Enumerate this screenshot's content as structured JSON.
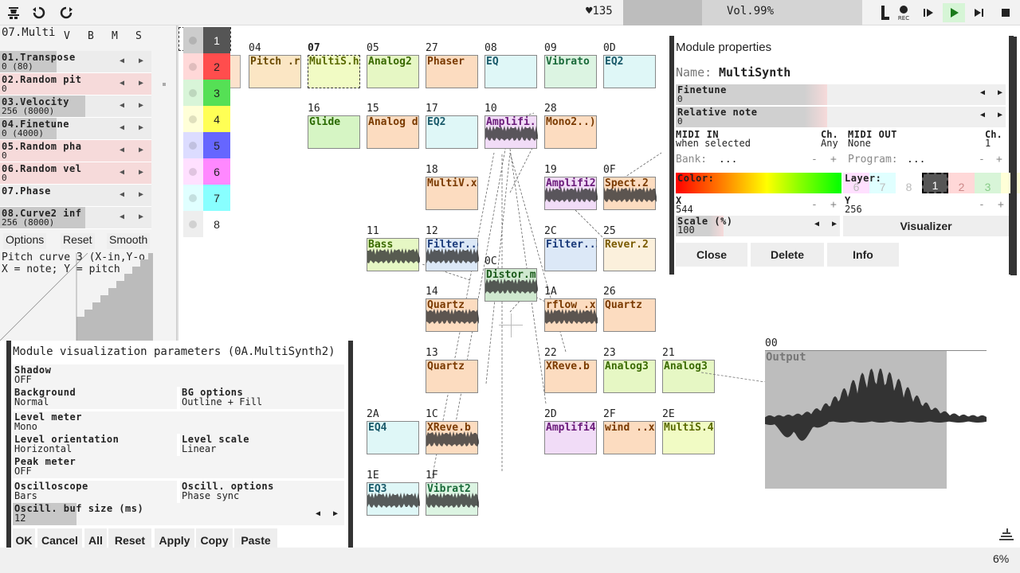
{
  "topbar": {
    "cpu": "♥135",
    "volume": "Vol.99%",
    "volume_fraction": 0.99
  },
  "left_panel": {
    "module_title": "07.Multi",
    "header_cols": [
      "V",
      "B",
      "M",
      "S"
    ],
    "controllers": [
      {
        "name": "01.Transpose",
        "value": "0 (80)",
        "fill": 0.5,
        "tint": "#ececec"
      },
      {
        "name": "02.Random pit",
        "value": "0",
        "fill": 0.0,
        "tint": "#f6dada"
      },
      {
        "name": "03.Velocity",
        "value": "256 (8000)",
        "fill": 0.75,
        "tint": "#ececec"
      },
      {
        "name": "04.Finetune",
        "value": "0 (4000)",
        "fill": 0.5,
        "tint": "#ececec"
      },
      {
        "name": "05.Random pha",
        "value": "0",
        "fill": 0.0,
        "tint": "#f6dada"
      },
      {
        "name": "06.Random vel",
        "value": "0",
        "fill": 0.0,
        "tint": "#f6dada"
      },
      {
        "name": "07.Phase",
        "value": "",
        "fill": 0.0,
        "tint": "#ececec"
      },
      {
        "name": "08.Curve2 inf",
        "value": "256 (8000)",
        "fill": 0.75,
        "tint": "#ececec"
      }
    ],
    "buttons": [
      "Options",
      "Reset",
      "Smooth"
    ],
    "curve_text_1": "Pitch curve 3 (X-in,Y-o",
    "curve_text_2": "X = note; Y = pitch"
  },
  "layers": {
    "items": [
      {
        "label": "1",
        "color": "#555555",
        "dot": "#cccccc"
      },
      {
        "label": "2",
        "color": "#ff4d4d",
        "dot": "#ffd8d8"
      },
      {
        "label": "3",
        "color": "#55e055",
        "dot": "#d8f5d8"
      },
      {
        "label": "4",
        "color": "#ffff55",
        "dot": "#ffffd8"
      },
      {
        "label": "5",
        "color": "#6666ff",
        "dot": "#dcdcff"
      },
      {
        "label": "6",
        "color": "#ff88ff",
        "dot": "#ffe0ff"
      },
      {
        "label": "7",
        "color": "#88ffff",
        "dot": "#e0ffff"
      },
      {
        "label": "8",
        "color": "#ffffff",
        "dot": "#eeeeee"
      }
    ]
  },
  "modules": [
    {
      "id": "04",
      "label": "Pitch .r",
      "color": "#fbe6c4",
      "text": "#6a4a00"
    },
    {
      "id": "07",
      "label": "MultiS.h",
      "color": "#f1fbc4",
      "text": "#5a6a00"
    },
    {
      "id": "05",
      "label": "Analog2",
      "color": "#e6f7c4",
      "text": "#3a6a00"
    },
    {
      "id": "27",
      "label": "Phaser",
      "color": "#fcdcc0",
      "text": "#7a3a00"
    },
    {
      "id": "08",
      "label": "EQ",
      "color": "#dff7f7",
      "text": "#1a5a6a"
    },
    {
      "id": "09",
      "label": "Vibrato",
      "color": "#dcf4e2",
      "text": "#1a6a3a"
    },
    {
      "id": "0D",
      "label": "EQ2",
      "color": "#dff7f7",
      "text": "#1a5a6a"
    },
    {
      "id": "16",
      "label": "Glide",
      "color": "#d6f5c4",
      "text": "#2a6a00"
    },
    {
      "id": "15",
      "label": "Analog d",
      "color": "#fcdcc0",
      "text": "#7a3a00"
    },
    {
      "id": "17",
      "label": "EQ2",
      "color": "#dff7f7",
      "text": "#1a5a6a"
    },
    {
      "id": "10",
      "label": "Amplifi.r",
      "color": "#f1dcf7",
      "text": "#6a1a7a"
    },
    {
      "id": "28",
      "label": "Mono2..)",
      "color": "#fcdcc0",
      "text": "#7a3a00"
    },
    {
      "id": "18",
      "label": "MultiV.x",
      "color": "#fcdcc0",
      "text": "#7a3a00"
    },
    {
      "id": "19",
      "label": "Amplifi2",
      "color": "#f1dcf7",
      "text": "#6a1a7a"
    },
    {
      "id": "0F",
      "label": "Spect.2",
      "color": "#fcdcc0",
      "text": "#7a3a00"
    },
    {
      "id": "11",
      "label": "Bass",
      "color": "#e6f7c4",
      "text": "#3a6a00"
    },
    {
      "id": "12",
      "label": "Filter..o",
      "color": "#dce8f7",
      "text": "#1a3a7a"
    },
    {
      "id": "2C",
      "label": "Filter..3",
      "color": "#dce8f7",
      "text": "#1a3a7a"
    },
    {
      "id": "25",
      "label": "Rever.2",
      "color": "#fbf0dc",
      "text": "#7a5a00"
    },
    {
      "id": "0C",
      "label": "Distor.m",
      "color": "#cfe8cf",
      "text": "#1a5a1a"
    },
    {
      "id": "14",
      "label": "Quartz",
      "color": "#fcdcc0",
      "text": "#7a3a00"
    },
    {
      "id": "1A",
      "label": "rflow .x",
      "color": "#fcdcc0",
      "text": "#7a3a00"
    },
    {
      "id": "26",
      "label": "Quartz",
      "color": "#fcdcc0",
      "text": "#7a3a00"
    },
    {
      "id": "13",
      "label": "Quartz",
      "color": "#fcdcc0",
      "text": "#7a3a00"
    },
    {
      "id": "22",
      "label": "XReve.b",
      "color": "#fcdcc0",
      "text": "#7a3a00"
    },
    {
      "id": "23",
      "label": "Analog3",
      "color": "#e6f7c4",
      "text": "#3a6a00"
    },
    {
      "id": "21",
      "label": "Analog3",
      "color": "#e6f7c4",
      "text": "#3a6a00"
    },
    {
      "id": "2A",
      "label": "EQ4",
      "color": "#dff7f7",
      "text": "#1a5a6a"
    },
    {
      "id": "1C",
      "label": "XReve.b",
      "color": "#fcdcc0",
      "text": "#7a3a00"
    },
    {
      "id": "2D",
      "label": "Amplifi4",
      "color": "#f1dcf7",
      "text": "#6a1a7a"
    },
    {
      "id": "2F",
      "label": "wind ..x",
      "color": "#fcdcc0",
      "text": "#7a3a00"
    },
    {
      "id": "2E",
      "label": "MultiS.4",
      "color": "#f1fbc4",
      "text": "#5a6a00"
    },
    {
      "id": "1E",
      "label": "EQ3",
      "color": "#dff7f7",
      "text": "#1a5a6a"
    },
    {
      "id": "1F",
      "label": "Vibrat2",
      "color": "#dcf4e2",
      "text": "#1a6a3a"
    }
  ],
  "partial_modules": [
    {
      "label": "0C lor",
      "color": "#fcdcc0"
    }
  ],
  "output": {
    "id": "00",
    "label": "Output"
  },
  "props": {
    "title": "Module properties",
    "name_label": "Name:",
    "name_value": "MultiSynth",
    "finetune_label": "Finetune",
    "finetune_value": "0",
    "relnote_label": "Relative note",
    "relnote_value": "0",
    "midi_in_label": "MIDI IN",
    "midi_in_value": "when selected",
    "midi_ch_label": "Ch.",
    "midi_ch_value": "Any",
    "midi_out_label": "MIDI OUT",
    "midi_out_value": "None",
    "midi_out_ch_label": "Ch.",
    "midi_out_ch_value": "1",
    "bank_label": "Bank:",
    "bank_value": "...",
    "program_label": "Program:",
    "program_value": "...",
    "color_label": "Color:",
    "layer_label": "Layer:",
    "layer_cells": [
      "6",
      "7",
      "8",
      "1",
      "2",
      "3",
      "4"
    ],
    "x_label": "X",
    "x_value": "544",
    "y_label": "Y",
    "y_value": "256",
    "scale_label": "Scale (%)",
    "scale_value": "100",
    "visualizer_label": "Visualizer",
    "close_label": "Close",
    "delete_label": "Delete",
    "info_label": "Info",
    "minus": "-",
    "plus": "+"
  },
  "vis": {
    "title": "Module visualization parameters (0A.MultiSynth2)",
    "rows": [
      {
        "k": "Shadow",
        "v": "OFF"
      },
      {
        "k": "Background",
        "v": "Normal"
      },
      {
        "k": "BG options",
        "v": "Outline + Fill"
      },
      {
        "k": "Level meter",
        "v": "Mono"
      },
      {
        "k": "Level orientation",
        "v": "Horizontal"
      },
      {
        "k": "Level scale",
        "v": "Linear"
      },
      {
        "k": "Peak meter",
        "v": "OFF"
      },
      {
        "k": "Oscilloscope",
        "v": "Bars"
      },
      {
        "k": "Oscill. options",
        "v": "Phase sync"
      },
      {
        "k": "Oscill. buf size (ms)",
        "v": "12"
      }
    ],
    "buttons": [
      "OK",
      "Cancel",
      "All",
      "Reset",
      "Apply",
      "Copy",
      "Paste"
    ]
  },
  "status": {
    "zoom": "6%"
  }
}
